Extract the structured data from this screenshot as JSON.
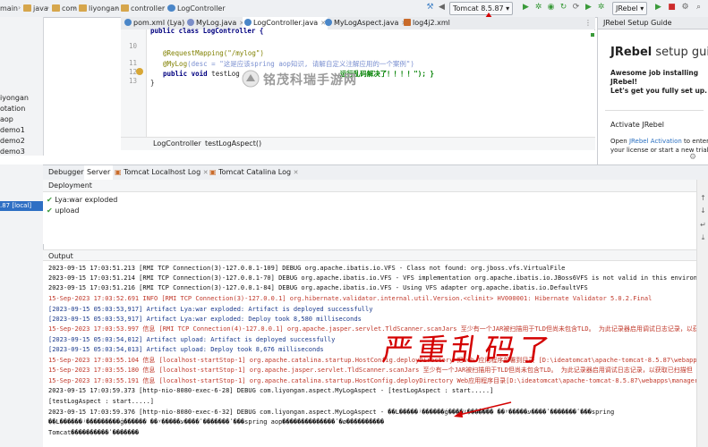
{
  "navbar": {
    "crumbs": [
      "main",
      "java",
      "com",
      "liyongan",
      "controller",
      "LogController"
    ],
    "run_config": "Tomcat 8.5.87",
    "jrebel_label": "JRebel"
  },
  "tabs": [
    {
      "label": "pom.xml (Lya)",
      "color": "#4a86c8"
    },
    {
      "label": "MyLog.java",
      "color": "#7b8ec8"
    },
    {
      "label": "LogController.java",
      "color": "#4a86c8"
    },
    {
      "label": "MyLogAspect.java",
      "color": "#4a86c8"
    },
    {
      "label": "log4j2.xml",
      "color": "#c96b2a"
    }
  ],
  "sidebar": {
    "items": [
      "iyongan",
      "otation",
      "aop",
      "demo1",
      "demo2",
      "demo3"
    ]
  },
  "code": {
    "line_numbers": [
      "10",
      "11",
      "12",
      "13"
    ],
    "line1": "public class LogController {",
    "line2": "@RequestMapping(\"/mylog\")",
    "line3_kw": "@MyLog",
    "line3_rest": "(desc = \"这是应该spring aop知识, 请解自定义注解应用的一个案例\")",
    "line4_kw": "public void",
    "line4_rest": " testLog",
    "line4_str": "运行乱码解决了！！！！\"); }",
    "line5": "}"
  },
  "editor_crumb": [
    "LogController",
    "testLogAspect()"
  ],
  "jrebel": {
    "header": "JRebel Setup Guide",
    "logo": "JRebel",
    "logo_suffix": " setup guide",
    "intro_line1": "Awesome job installing",
    "intro_line2": "JRebel!",
    "intro_line3": "Let's get you fully set up.",
    "activate_title": "Activate JRebel",
    "activate_text": "Open",
    "activate_link": "JRebel Activation",
    "activate_text2": " to enter",
    "activate_text3": "your license or start a new trial"
  },
  "run_tabs": [
    "Debugger",
    "Server",
    "Tomcat Localhost Log",
    "Tomcat Catalina Log"
  ],
  "run_left": {
    "server": ".87 [local]"
  },
  "deployment": {
    "header": "Deployment",
    "items": [
      "Lya:war exploded",
      "upload"
    ]
  },
  "output": {
    "header": "Output",
    "lines": [
      {
        "text": "2023-09-15 17:03:51.213 [RMI TCP Connection(3)-127.0.0.1-109] DEBUG org.apache.ibatis.io.VFS - Class not found: org.jboss.vfs.VirtualFile",
        "c": "dark"
      },
      {
        "text": "2023-09-15 17:03:51.214 [RMI TCP Connection(3)-127.0.0.1-70] DEBUG org.apache.ibatis.io.VFS - VFS implementation org.apache.ibatis.io.JBoss6VFS is not valid in this environment.",
        "c": "dark"
      },
      {
        "text": "2023-09-15 17:03:51.216 [RMI TCP Connection(3)-127.0.0.1-84] DEBUG org.apache.ibatis.io.VFS - Using VFS adapter org.apache.ibatis.io.DefaultVFS",
        "c": "dark"
      },
      {
        "text": "15-Sep-2023 17:03:52.691 INFO [RMI TCP Connection(3)-127.0.0.1] org.hibernate.validator.internal.util.Version.<clinit> HV000001: Hibernate Validator 5.0.2.Final",
        "c": "red"
      },
      {
        "text": "[2023-09-15 05:03:53,917] Artifact Lya:war exploded: Artifact is deployed successfully",
        "c": "blue"
      },
      {
        "text": "[2023-09-15 05:03:53,917] Artifact Lya:war exploded: Deploy took 8,580 milliseconds",
        "c": "blue"
      },
      {
        "text": "15-Sep-2023 17:03:53.997 信息 [RMI TCP Connection(4)-127.0.0.1] org.apache.jasper.servlet.TldScanner.scanJars 至少有一个JAR被扫描用于TLD但尚未包含TLD。 为此记录器启用调试日志记录，以获",
        "c": "red"
      },
      {
        "text": "[2023-09-15 05:03:54,012] Artifact upload: Artifact is deployed successfully",
        "c": "blue"
      },
      {
        "text": "[2023-09-15 05:03:54,013] Artifact upload: Deploy took 8,676 milliseconds",
        "c": "blue"
      },
      {
        "text": "15-Sep-2023 17:03:55.104 信息 [localhost-startStop-1] org.apache.catalina.startup.HostConfig.deployDirectory 把web 应用程序部署到目录 [D:\\ideatomcat\\apache-tomcat-8.5.87\\webapps\\mar",
        "c": "red"
      },
      {
        "text": "15-Sep-2023 17:03:55.180 信息 [localhost-startStop-1] org.apache.jasper.servlet.TldScanner.scanJars 至少有一个JAR被扫描用于TLD但尚未包含TLD。 为此记录器启用调试日志记录，以获取已扫描但",
        "c": "red"
      },
      {
        "text": "15-Sep-2023 17:03:55.191 信息 [localhost-startStop-1] org.apache.catalina.startup.HostConfig.deployDirectory Web应用程序目录[D:\\ideatomcat\\apache-tomcat-8.5.87\\webapps\\manager]的部",
        "c": "red"
      },
      {
        "text": "2023-09-15 17:03:59.373 [http-nio-8080-exec-6-28] DEBUG com.liyongan.aspect.MyLogAspect - [testLogAspect : start.....]",
        "c": "dark"
      },
      {
        "text": "[testLogAspect : start.....]",
        "c": "dark"
      },
      {
        "text": "2023-09-15 17:03:59.376 [http-nio-8080-exec-6-32] DEBUG com.liyongan.aspect.MyLogAspect - ��L�����ʲ������ǵ����ʸ������� ��ʸ�����ע����ʹ�������ʹ���spring",
        "c": "dark"
      },
      {
        "text": "��L������ʲ���������ǵ������ ��ʸ�����ע����ʹ�������ʹ���spring aop��������������ʹ�ø����������",
        "c": "dark"
      },
      {
        "text": "Tomcat����������ʹ�������",
        "c": "dark"
      }
    ]
  },
  "watermark": "铭茂科瑞手游网",
  "annotation": "严重乱码了",
  "colors": {
    "accent": "#4a86c8",
    "annotation_red": "#d40000",
    "log_red": "#c0392b",
    "log_blue": "#1b3a8c"
  }
}
